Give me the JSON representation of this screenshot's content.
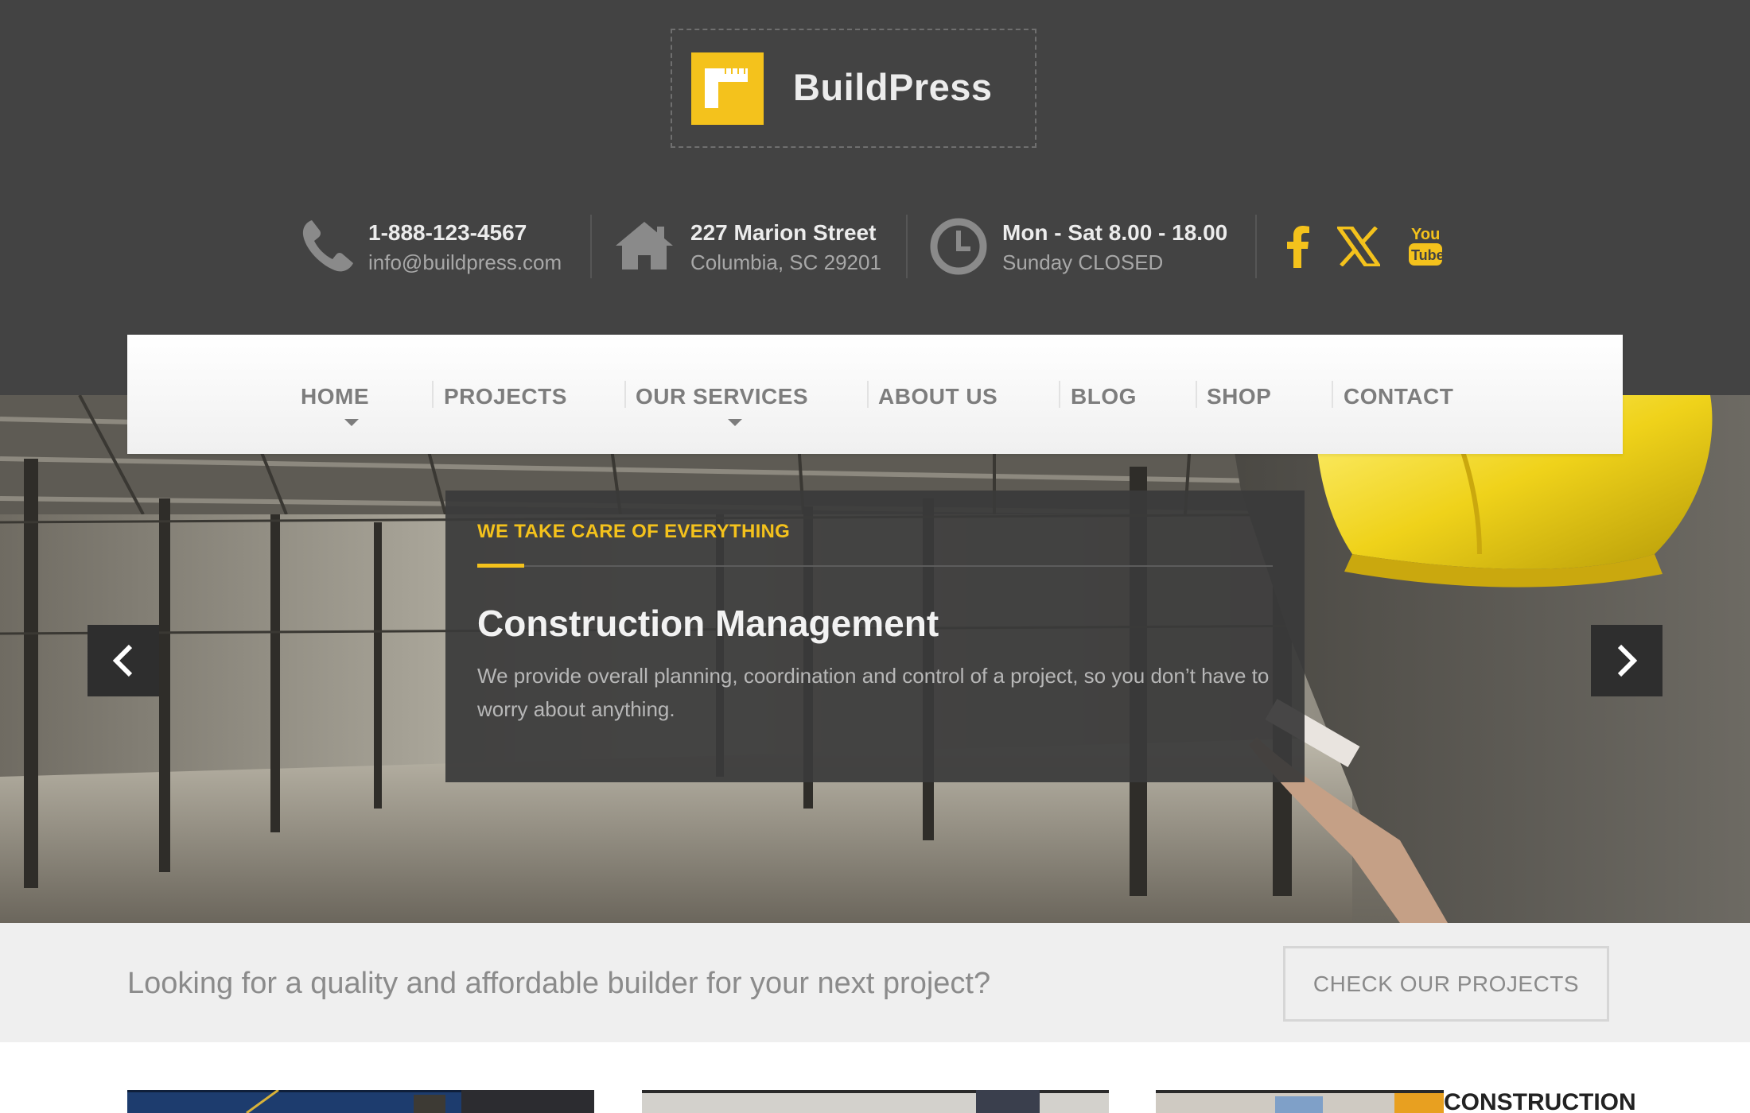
{
  "brand": {
    "name": "BuildPress",
    "accent_color": "#f4c21c",
    "icon": "carpenter-square-logo-icon"
  },
  "contact": {
    "phone": "1-888-123-4567",
    "email": "info@buildpress.com",
    "street": "227 Marion Street",
    "city": "Columbia, SC 29201",
    "hours": "Mon - Sat 8.00 - 18.00",
    "closed": "Sunday CLOSED"
  },
  "social": [
    "facebook-icon",
    "x-icon",
    "youtube-icon"
  ],
  "nav": {
    "items": [
      {
        "label": "HOME",
        "has_dropdown": true
      },
      {
        "label": "PROJECTS",
        "has_dropdown": false
      },
      {
        "label": "OUR SERVICES",
        "has_dropdown": true
      },
      {
        "label": "ABOUT US",
        "has_dropdown": false
      },
      {
        "label": "BLOG",
        "has_dropdown": false
      },
      {
        "label": "SHOP",
        "has_dropdown": false
      },
      {
        "label": "CONTACT",
        "has_dropdown": false
      }
    ]
  },
  "hero": {
    "kicker": "WE TAKE CARE OF EVERYTHING",
    "title": "Construction Management",
    "text": "We provide overall planning, coordination and control of a project, so you don’t have to worry about anything."
  },
  "cta": {
    "text": "Looking for a quality and affordable builder for your next project?",
    "button": "CHECK OUR PROJECTS"
  },
  "cards": {
    "third_title": "CONSTRUCTION"
  }
}
